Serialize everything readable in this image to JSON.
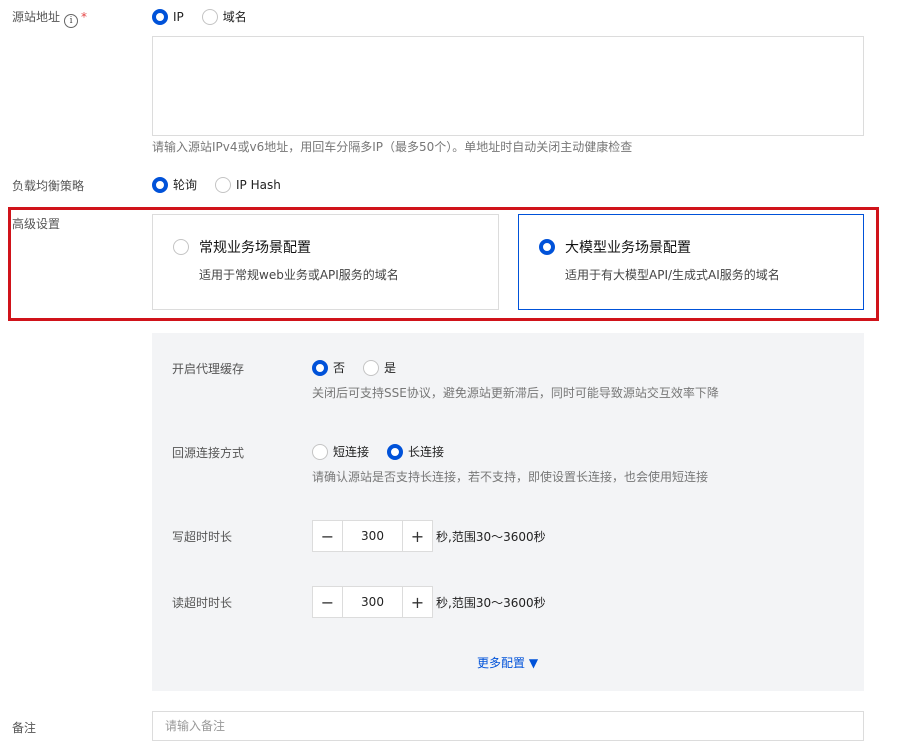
{
  "origin": {
    "label": "源站地址",
    "info_icon": "i",
    "required_mark": "*",
    "options": [
      {
        "label": "IP",
        "selected": true
      },
      {
        "label": "域名",
        "selected": false
      }
    ],
    "textarea_value": "",
    "hint": "请输入源站IPv4或v6地址，用回车分隔多IP（最多50个）。单地址时自动关闭主动健康检查"
  },
  "load_balance": {
    "label": "负载均衡策略",
    "options": [
      {
        "label": "轮询",
        "selected": true
      },
      {
        "label": "IP Hash",
        "selected": false
      }
    ]
  },
  "advanced": {
    "label": "高级设置",
    "cards": [
      {
        "title": "常规业务场景配置",
        "desc": "适用于常规web业务或API服务的域名",
        "selected": false
      },
      {
        "title": "大模型业务场景配置",
        "desc": "适用于有大模型API/生成式AI服务的域名",
        "selected": true
      }
    ]
  },
  "panel": {
    "proxy_cache": {
      "label": "开启代理缓存",
      "options": [
        {
          "label": "否",
          "selected": true
        },
        {
          "label": "是",
          "selected": false
        }
      ],
      "hint": "关闭后可支持SSE协议，避免源站更新滞后，同时可能导致源站交互效率下降"
    },
    "origin_connection": {
      "label": "回源连接方式",
      "options": [
        {
          "label": "短连接",
          "selected": false
        },
        {
          "label": "长连接",
          "selected": true
        }
      ],
      "hint": "请确认源站是否支持长连接，若不支持，即使设置长连接，也会使用短连接"
    },
    "write_timeout": {
      "label": "写超时时长",
      "value": "300",
      "unit": "秒,范围30～3600秒"
    },
    "read_timeout": {
      "label": "读超时时长",
      "value": "300",
      "unit": "秒,范围30～3600秒"
    },
    "stepper_minus": "−",
    "stepper_plus": "+",
    "more_config": "更多配置 ▼"
  },
  "remark": {
    "label": "备注",
    "placeholder": "请输入备注"
  },
  "colors": {
    "accent": "#0052d9",
    "highlight_border": "#d0131a",
    "panel_bg": "#f3f4f6"
  }
}
